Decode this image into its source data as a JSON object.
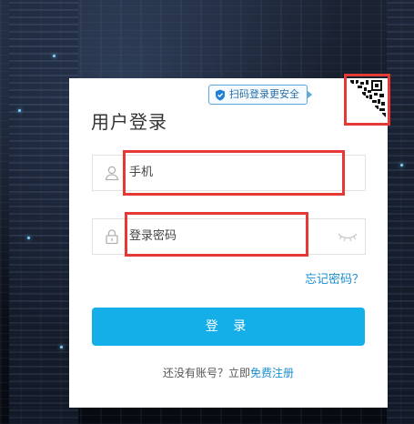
{
  "login_card": {
    "title": "用户登录",
    "qr_tip": "扫码登录更安全",
    "phone_field": {
      "value": "手机",
      "icon": "user-icon"
    },
    "password_field": {
      "value": "登录密码",
      "icon": "lock-icon",
      "toggle_icon": "eye-closed-icon"
    },
    "forgot_password": "忘记密码？",
    "login_button": "登 录",
    "register": {
      "prompt": "还没有账号？立即",
      "link": "免费注册"
    }
  },
  "highlight_color": "#e53935",
  "accent_color": "#14aee8",
  "link_color": "#1a8fd0"
}
